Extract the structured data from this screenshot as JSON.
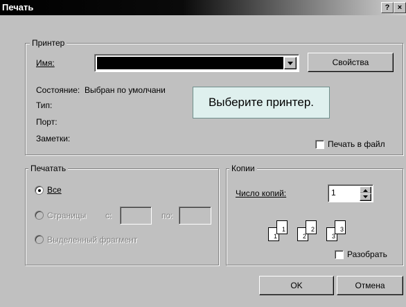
{
  "window": {
    "title": "Печать",
    "help_button": "?",
    "close_button": "×"
  },
  "printer": {
    "group_label": "Принтер",
    "name_label": "Имя:",
    "name_value": "",
    "properties_button": "Свойства",
    "status_label": "Состояние:",
    "status_value": "Выбран по умолчани",
    "type_label": "Тип:",
    "port_label": "Порт:",
    "notes_label": "Заметки:",
    "print_to_file_label": "Печать в файл",
    "print_to_file_checked": false
  },
  "tooltip": {
    "text": "Выберите принтер."
  },
  "print_range": {
    "group_label": "Печатать",
    "all_label": "Все",
    "pages_label": "Страницы",
    "from_label": "с:",
    "to_label": "по:",
    "from_value": "",
    "to_value": "",
    "selection_label": "Выделенный фрагмент",
    "selected": "all"
  },
  "copies": {
    "group_label": "Копии",
    "count_label": "Число копий:",
    "count_value": "1",
    "collate_label": "Разобрать",
    "collate_checked": false,
    "collate_pages": [
      "1",
      "1",
      "2",
      "2",
      "3",
      "3"
    ]
  },
  "footer": {
    "ok_button": "OK",
    "cancel_button": "Отмена"
  }
}
